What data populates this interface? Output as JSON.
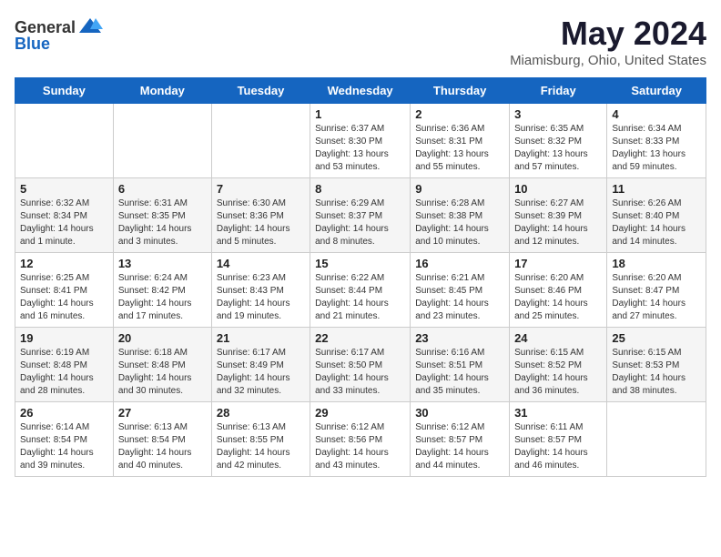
{
  "header": {
    "logo": {
      "general": "General",
      "blue": "Blue"
    },
    "title": "May 2024",
    "subtitle": "Miamisburg, Ohio, United States"
  },
  "calendar": {
    "days_of_week": [
      "Sunday",
      "Monday",
      "Tuesday",
      "Wednesday",
      "Thursday",
      "Friday",
      "Saturday"
    ],
    "weeks": [
      [
        {
          "day": "",
          "info": ""
        },
        {
          "day": "",
          "info": ""
        },
        {
          "day": "",
          "info": ""
        },
        {
          "day": "1",
          "info": "Sunrise: 6:37 AM\nSunset: 8:30 PM\nDaylight: 13 hours\nand 53 minutes."
        },
        {
          "day": "2",
          "info": "Sunrise: 6:36 AM\nSunset: 8:31 PM\nDaylight: 13 hours\nand 55 minutes."
        },
        {
          "day": "3",
          "info": "Sunrise: 6:35 AM\nSunset: 8:32 PM\nDaylight: 13 hours\nand 57 minutes."
        },
        {
          "day": "4",
          "info": "Sunrise: 6:34 AM\nSunset: 8:33 PM\nDaylight: 13 hours\nand 59 minutes."
        }
      ],
      [
        {
          "day": "5",
          "info": "Sunrise: 6:32 AM\nSunset: 8:34 PM\nDaylight: 14 hours\nand 1 minute."
        },
        {
          "day": "6",
          "info": "Sunrise: 6:31 AM\nSunset: 8:35 PM\nDaylight: 14 hours\nand 3 minutes."
        },
        {
          "day": "7",
          "info": "Sunrise: 6:30 AM\nSunset: 8:36 PM\nDaylight: 14 hours\nand 5 minutes."
        },
        {
          "day": "8",
          "info": "Sunrise: 6:29 AM\nSunset: 8:37 PM\nDaylight: 14 hours\nand 8 minutes."
        },
        {
          "day": "9",
          "info": "Sunrise: 6:28 AM\nSunset: 8:38 PM\nDaylight: 14 hours\nand 10 minutes."
        },
        {
          "day": "10",
          "info": "Sunrise: 6:27 AM\nSunset: 8:39 PM\nDaylight: 14 hours\nand 12 minutes."
        },
        {
          "day": "11",
          "info": "Sunrise: 6:26 AM\nSunset: 8:40 PM\nDaylight: 14 hours\nand 14 minutes."
        }
      ],
      [
        {
          "day": "12",
          "info": "Sunrise: 6:25 AM\nSunset: 8:41 PM\nDaylight: 14 hours\nand 16 minutes."
        },
        {
          "day": "13",
          "info": "Sunrise: 6:24 AM\nSunset: 8:42 PM\nDaylight: 14 hours\nand 17 minutes."
        },
        {
          "day": "14",
          "info": "Sunrise: 6:23 AM\nSunset: 8:43 PM\nDaylight: 14 hours\nand 19 minutes."
        },
        {
          "day": "15",
          "info": "Sunrise: 6:22 AM\nSunset: 8:44 PM\nDaylight: 14 hours\nand 21 minutes."
        },
        {
          "day": "16",
          "info": "Sunrise: 6:21 AM\nSunset: 8:45 PM\nDaylight: 14 hours\nand 23 minutes."
        },
        {
          "day": "17",
          "info": "Sunrise: 6:20 AM\nSunset: 8:46 PM\nDaylight: 14 hours\nand 25 minutes."
        },
        {
          "day": "18",
          "info": "Sunrise: 6:20 AM\nSunset: 8:47 PM\nDaylight: 14 hours\nand 27 minutes."
        }
      ],
      [
        {
          "day": "19",
          "info": "Sunrise: 6:19 AM\nSunset: 8:48 PM\nDaylight: 14 hours\nand 28 minutes."
        },
        {
          "day": "20",
          "info": "Sunrise: 6:18 AM\nSunset: 8:48 PM\nDaylight: 14 hours\nand 30 minutes."
        },
        {
          "day": "21",
          "info": "Sunrise: 6:17 AM\nSunset: 8:49 PM\nDaylight: 14 hours\nand 32 minutes."
        },
        {
          "day": "22",
          "info": "Sunrise: 6:17 AM\nSunset: 8:50 PM\nDaylight: 14 hours\nand 33 minutes."
        },
        {
          "day": "23",
          "info": "Sunrise: 6:16 AM\nSunset: 8:51 PM\nDaylight: 14 hours\nand 35 minutes."
        },
        {
          "day": "24",
          "info": "Sunrise: 6:15 AM\nSunset: 8:52 PM\nDaylight: 14 hours\nand 36 minutes."
        },
        {
          "day": "25",
          "info": "Sunrise: 6:15 AM\nSunset: 8:53 PM\nDaylight: 14 hours\nand 38 minutes."
        }
      ],
      [
        {
          "day": "26",
          "info": "Sunrise: 6:14 AM\nSunset: 8:54 PM\nDaylight: 14 hours\nand 39 minutes."
        },
        {
          "day": "27",
          "info": "Sunrise: 6:13 AM\nSunset: 8:54 PM\nDaylight: 14 hours\nand 40 minutes."
        },
        {
          "day": "28",
          "info": "Sunrise: 6:13 AM\nSunset: 8:55 PM\nDaylight: 14 hours\nand 42 minutes."
        },
        {
          "day": "29",
          "info": "Sunrise: 6:12 AM\nSunset: 8:56 PM\nDaylight: 14 hours\nand 43 minutes."
        },
        {
          "day": "30",
          "info": "Sunrise: 6:12 AM\nSunset: 8:57 PM\nDaylight: 14 hours\nand 44 minutes."
        },
        {
          "day": "31",
          "info": "Sunrise: 6:11 AM\nSunset: 8:57 PM\nDaylight: 14 hours\nand 46 minutes."
        },
        {
          "day": "",
          "info": ""
        }
      ]
    ]
  }
}
